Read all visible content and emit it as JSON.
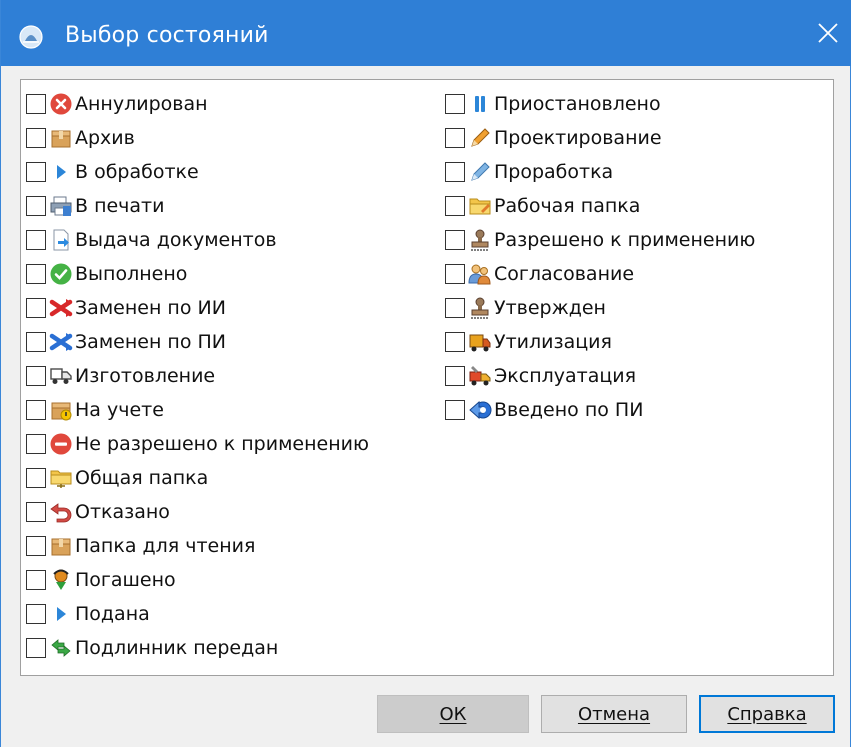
{
  "window": {
    "title": "Выбор состояний",
    "close_glyph": "✕",
    "accent_color": "#2f7fd6"
  },
  "states_left": [
    {
      "label": "Аннулирован",
      "icon": "cancel-circle-icon",
      "checked": false
    },
    {
      "label": "Архив",
      "icon": "archive-box-icon",
      "checked": false
    },
    {
      "label": "В обработке",
      "icon": "play-arrow-icon",
      "checked": false
    },
    {
      "label": "В печати",
      "icon": "printer-icon",
      "checked": false
    },
    {
      "label": "Выдача документов",
      "icon": "document-issue-icon",
      "checked": false
    },
    {
      "label": "Выполнено",
      "icon": "check-circle-icon",
      "checked": false
    },
    {
      "label": "Заменен по ИИ",
      "icon": "replace-red-icon",
      "checked": false
    },
    {
      "label": "Заменен по ПИ",
      "icon": "replace-blue-icon",
      "checked": false
    },
    {
      "label": "Изготовление",
      "icon": "truck-icon",
      "checked": false
    },
    {
      "label": "На учете",
      "icon": "registered-box-icon",
      "checked": false
    },
    {
      "label": "Не разрешено к применению",
      "icon": "no-entry-icon",
      "checked": false
    },
    {
      "label": "Общая папка",
      "icon": "shared-folder-icon",
      "checked": false
    },
    {
      "label": "Отказано",
      "icon": "undo-arrow-icon",
      "checked": false
    },
    {
      "label": "Папка для чтения",
      "icon": "readonly-box-icon",
      "checked": false
    },
    {
      "label": "Погашено",
      "icon": "stamp-down-icon",
      "checked": false
    },
    {
      "label": "Подана",
      "icon": "play-arrow-icon",
      "checked": false
    },
    {
      "label": "Подлинник передан",
      "icon": "handover-arrows-icon",
      "checked": false
    }
  ],
  "states_right": [
    {
      "label": "Приостановлено",
      "icon": "pause-icon",
      "checked": false
    },
    {
      "label": "Проектирование",
      "icon": "pencil-orange-icon",
      "checked": false
    },
    {
      "label": "Проработка",
      "icon": "pencil-blue-icon",
      "checked": false
    },
    {
      "label": "Рабочая папка",
      "icon": "work-folder-icon",
      "checked": false
    },
    {
      "label": "Разрешено к применению",
      "icon": "approval-stamp-icon",
      "checked": false
    },
    {
      "label": "Согласование",
      "icon": "users-agreement-icon",
      "checked": false
    },
    {
      "label": "Утвержден",
      "icon": "approval-stamp-icon",
      "checked": false
    },
    {
      "label": "Утилизация",
      "icon": "disposal-truck-icon",
      "checked": false
    },
    {
      "label": "Эксплуатация",
      "icon": "operation-truck-icon",
      "checked": false
    },
    {
      "label": "Введено по ПИ",
      "icon": "introduced-blue-icon",
      "checked": false
    }
  ],
  "buttons": {
    "ok": "ОК",
    "cancel": "Отмена",
    "help": "Справка"
  }
}
